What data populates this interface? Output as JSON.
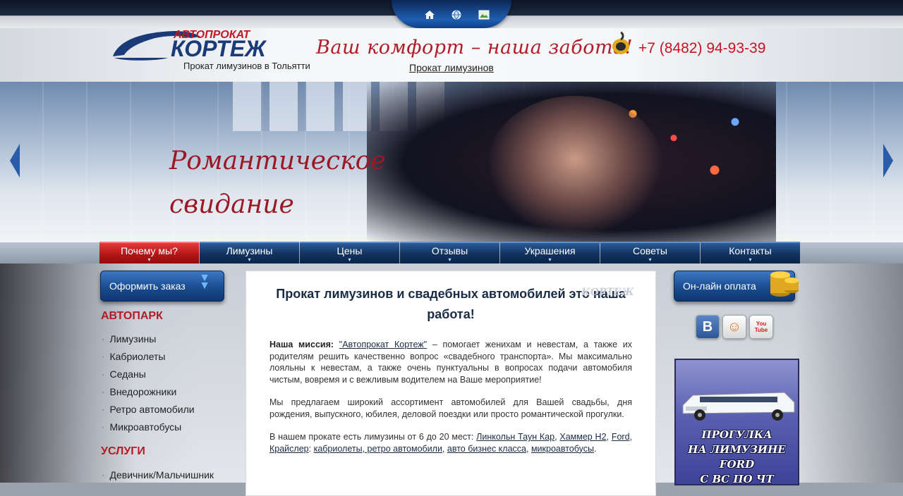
{
  "header": {
    "logo_top": "АВТОПРОКАТ",
    "logo_main": "КОРТЕЖ",
    "logo_sub": "Прокат лимузинов в Тольятти",
    "slogan": "Ваш комфорт – наша забота!",
    "link": "Прокат лимузинов",
    "phone": "+7 (8482) 94-93-39"
  },
  "top_icons": [
    "home-icon",
    "globe-icon",
    "sitemap-icon"
  ],
  "banner": {
    "line1": "Романтическое",
    "line2": "свидание"
  },
  "nav": [
    {
      "label": "Почему мы?",
      "active": true
    },
    {
      "label": "Лимузины"
    },
    {
      "label": "Цены"
    },
    {
      "label": "Отзывы"
    },
    {
      "label": "Украшения"
    },
    {
      "label": "Советы"
    },
    {
      "label": "Контакты"
    }
  ],
  "left": {
    "order_label": "Оформить заказ",
    "fleet_heading": "АВТОПАРК",
    "fleet": [
      "Лимузины",
      "Кабриолеты",
      "Седаны",
      "Внедорожники",
      "Ретро автомобили",
      "Микроавтобусы"
    ],
    "services_heading": "УСЛУГИ",
    "services": [
      "Девичник/Мальчишник"
    ]
  },
  "content": {
    "title": "Прокат лимузинов и свадебных автомобилей это наша работа!",
    "watermark": "КОРТЕЖ",
    "mission_label": "Наша миссия:",
    "mission_link": "\"Автопрокат Кортеж\"",
    "mission_text": " – помогает женихам и невестам, а также их родителям решить качественно вопрос «свадебного транспорта». Мы максимально лояльны к невестам, а также очень пунктуальны в вопросах подачи автомобиля чистым, вовремя и с вежливым водителем на Ваше мероприятие!",
    "para2": "Мы предлагаем широкий ассортимент автомобилей для Вашей свадьбы, дня рождения, выпускного, юбилея, деловой поездки или просто романтической прогулки.",
    "para3_intro": "В нашем прокате есть лимузины от 6 до 20 мест: ",
    "para3_links": [
      "Линкольн Таун Кар",
      "Хаммер Н2",
      "Ford",
      "Крайслер",
      "кабриолеты, ретро автомобили",
      "авто бизнес класса",
      "микроавтобусы"
    ],
    "sep1": ", ",
    "sep2": ", ",
    "sep3": ", ",
    "sep4": ": ",
    "sep5": ", ",
    "sep6": ", ",
    "end": "."
  },
  "right": {
    "pay_label": "Он-лайн оплата",
    "social": [
      {
        "name": "vk-icon",
        "label": "B"
      },
      {
        "name": "odnoklassniki-icon",
        "label": "☺"
      },
      {
        "name": "youtube-icon",
        "label": "You Tube"
      }
    ],
    "promo_lines": [
      "ПРОГУЛКА",
      "НА ЛИМУЗИНЕ",
      "FORD",
      "С ВС ПО ЧТ"
    ]
  },
  "colors": {
    "accent_red": "#b41b27",
    "nav_blue": "#123461",
    "nav_active": "#b21616"
  }
}
